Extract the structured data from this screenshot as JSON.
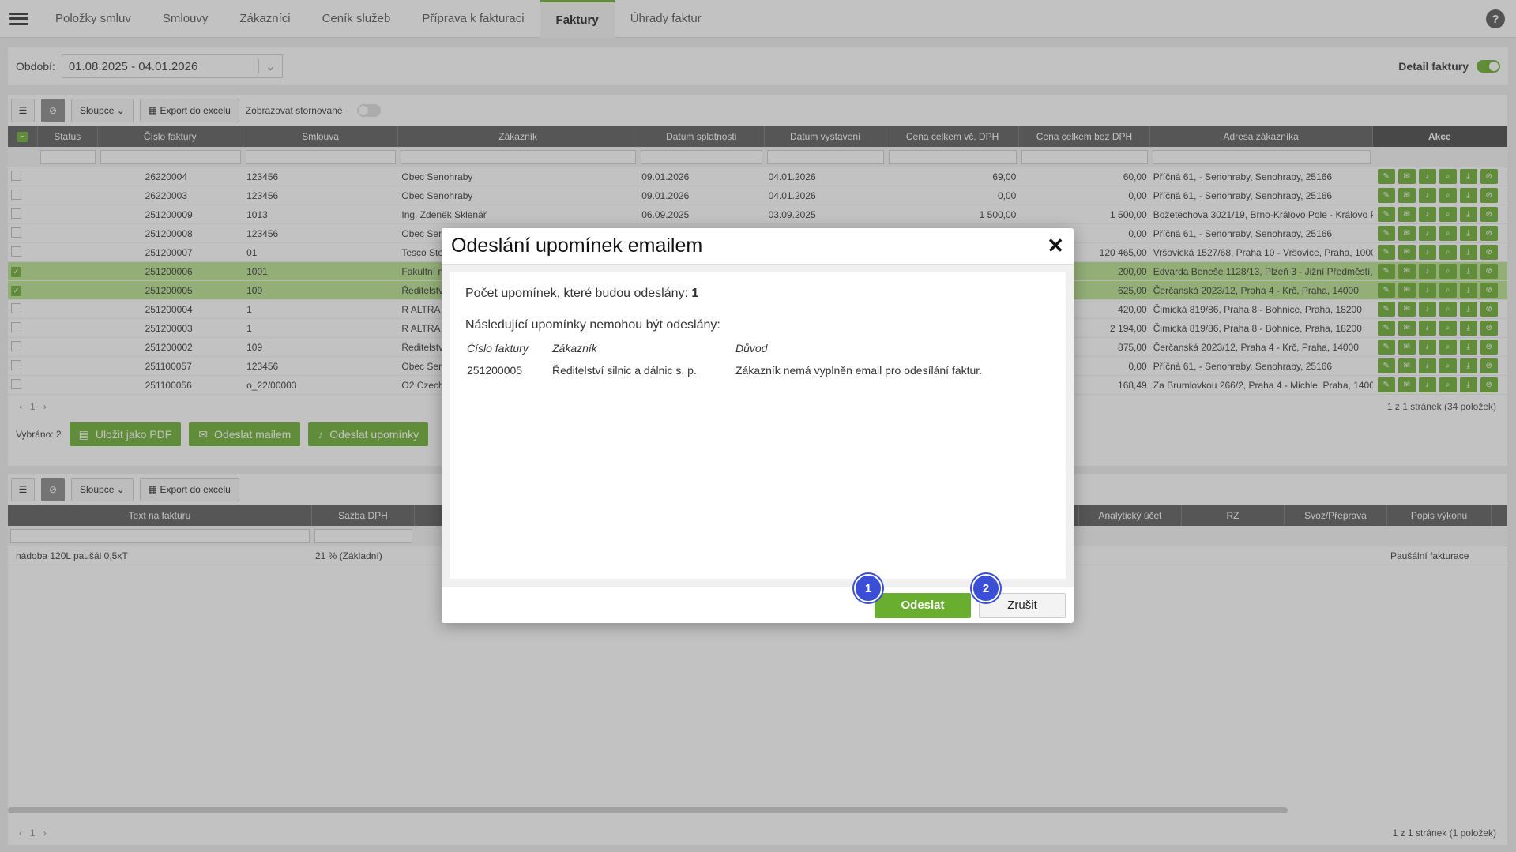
{
  "nav": {
    "tabs": [
      "Položky smluv",
      "Smlouvy",
      "Zákazníci",
      "Ceník služeb",
      "Příprava k fakturaci",
      "Faktury",
      "Úhrady faktur"
    ],
    "active": "Faktury",
    "help": "?"
  },
  "period": {
    "label": "Období:",
    "value": "01.08.2025 - 04.01.2026"
  },
  "detail": {
    "label": "Detail faktury"
  },
  "toolbar": {
    "columns": "Sloupce",
    "export": "Export do excelu",
    "show_cancelled": "Zobrazovat stornované"
  },
  "grid": {
    "columns": [
      "Status",
      "Číslo faktury",
      "Smlouva",
      "Zákazník",
      "Datum splatnosti",
      "Datum vystavení",
      "Cena celkem vč. DPH",
      "Cena celkem bez DPH",
      "Adresa zákazníka",
      "Akce"
    ],
    "rows": [
      {
        "id": "26220004",
        "contract": "123456",
        "customer": "Obec Senohraby",
        "due": "09.01.2026",
        "issued": "04.01.2026",
        "total_vat": "69,00",
        "total": "60,00",
        "address": "Příčná 61, - Senohraby, Senohraby, 25166",
        "sel": false
      },
      {
        "id": "26220003",
        "contract": "123456",
        "customer": "Obec Senohraby",
        "due": "09.01.2026",
        "issued": "04.01.2026",
        "total_vat": "0,00",
        "total": "0,00",
        "address": "Příčná 61, - Senohraby, Senohraby, 25166",
        "sel": false
      },
      {
        "id": "251200009",
        "contract": "1013",
        "customer": "Ing. Zdeněk Sklenář",
        "due": "06.09.2025",
        "issued": "03.09.2025",
        "total_vat": "1 500,00",
        "total": "1 500,00",
        "address": "Božetěchova 3021/19, Brno-Královo Pole - Královo Po",
        "sel": false
      },
      {
        "id": "251200008",
        "contract": "123456",
        "customer": "Obec Senc",
        "due": "",
        "issued": "",
        "total_vat": "",
        "total": "0,00",
        "address": "Příčná 61, - Senohraby, Senohraby, 25166",
        "sel": false
      },
      {
        "id": "251200007",
        "contract": "01",
        "customer": "Tesco Stor",
        "due": "",
        "issued": "",
        "total_vat": "",
        "total": "120 465,00",
        "address": "Vršovická 1527/68, Praha 10 - Vršovice, Praha, 10000",
        "sel": false
      },
      {
        "id": "251200006",
        "contract": "1001",
        "customer": "Fakultní n",
        "due": "",
        "issued": "",
        "total_vat": "",
        "total": "200,00",
        "address": "Edvarda Beneše 1128/13, Plzeň 3 - Jižní Předměstí, Pl",
        "sel": true
      },
      {
        "id": "251200005",
        "contract": "109",
        "customer": "Ředitelství",
        "due": "",
        "issued": "",
        "total_vat": "",
        "total": "625,00",
        "address": "Čerčanská 2023/12, Praha 4 - Krč, Praha, 14000",
        "sel": true
      },
      {
        "id": "251200004",
        "contract": "1",
        "customer": "R ALTRA sp",
        "due": "",
        "issued": "",
        "total_vat": "",
        "total": "420,00",
        "address": "Čimická 819/86, Praha 8 - Bohnice, Praha, 18200",
        "sel": false
      },
      {
        "id": "251200003",
        "contract": "1",
        "customer": "R ALTRA sp",
        "due": "",
        "issued": "",
        "total_vat": "",
        "total": "2 194,00",
        "address": "Čimická 819/86, Praha 8 - Bohnice, Praha, 18200",
        "sel": false
      },
      {
        "id": "251200002",
        "contract": "109",
        "customer": "Ředitelství",
        "due": "",
        "issued": "",
        "total_vat": "",
        "total": "875,00",
        "address": "Čerčanská 2023/12, Praha 4 - Krč, Praha, 14000",
        "sel": false
      },
      {
        "id": "251100057",
        "contract": "123456",
        "customer": "Obec Senc",
        "due": "",
        "issued": "",
        "total_vat": "",
        "total": "0,00",
        "address": "Příčná 61, - Senohraby, Senohraby, 25166",
        "sel": false
      },
      {
        "id": "251100056",
        "contract": "o_22/00003",
        "customer": "O2 Czech",
        "due": "",
        "issued": "",
        "total_vat": "",
        "total": "168,49",
        "address": "Za Brumlovkou 266/2, Praha 4 - Michle, Praha, 14000",
        "sel": false
      }
    ]
  },
  "pager": {
    "page": "1",
    "info": "1 z 1 stránek (34 položek)",
    "prev": "‹",
    "next": "›"
  },
  "actions": {
    "selected": "Vybráno: 2",
    "pdf": "Uložit jako PDF",
    "mail": "Odeslat mailem",
    "reminders": "Odeslat upomínky"
  },
  "lower": {
    "columns_left": [
      "Text na fakturu",
      "Sazba DPH"
    ],
    "columns_right": [
      "Analytický účet",
      "RZ",
      "Svoz/Přeprava",
      "Popis výkonu"
    ],
    "row": {
      "text": "nádoba 120L paušál 0,5xT",
      "vat": "21 % (Základní)",
      "desc": "Paušální fakturace"
    },
    "pager_page": "1",
    "pager_info": "1 z 1 stránek (1 položek)"
  },
  "modal": {
    "title": "Odeslání upomínek emailem",
    "count_label": "Počet upomínek, které budou odeslány:",
    "count": "1",
    "cannot_label": "Následující upomínky nemohou být odeslány:",
    "headers": [
      "Číslo faktury",
      "Zákazník",
      "Důvod"
    ],
    "rows": [
      {
        "id": "251200005",
        "customer": "Ředitelství silnic a dálnic s. p.",
        "reason": "Zákazník nemá vyplněn email pro odesílání faktur."
      }
    ],
    "ok": "Odeslat",
    "cancel": "Zrušit"
  },
  "badges": [
    "1",
    "2"
  ]
}
